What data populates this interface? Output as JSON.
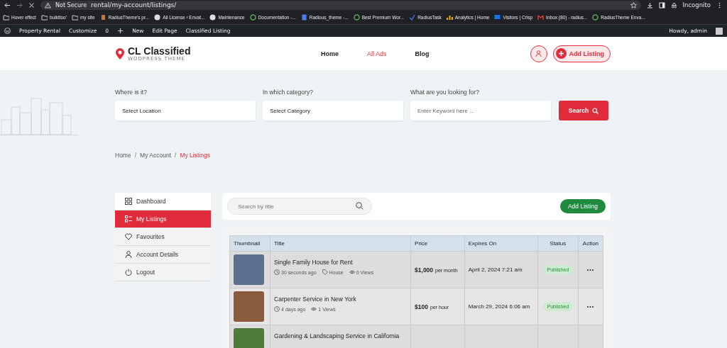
{
  "browser": {
    "security": "Not Secure",
    "url": "rental/my-account/listings/",
    "profile": "Incognito"
  },
  "bookmarks": [
    {
      "label": "Hover effect",
      "kind": "folder"
    },
    {
      "label": "buildtoo'",
      "kind": "folder"
    },
    {
      "label": "my site",
      "kind": "folder"
    },
    {
      "label": "RadiusTheme's pr...",
      "kind": "page"
    },
    {
      "label": "All License ‹ Envat...",
      "kind": "wp"
    },
    {
      "label": "Maintenance",
      "kind": "wp"
    },
    {
      "label": "Documentation -...",
      "kind": "g"
    },
    {
      "label": "Radious_theme -...",
      "kind": "doc"
    },
    {
      "label": "Best Premium Wor...",
      "kind": "g"
    },
    {
      "label": "RadiusTask",
      "kind": "task"
    },
    {
      "label": "Analytics | Home",
      "kind": "chart"
    },
    {
      "label": "Visitors | Crisp",
      "kind": "chat"
    },
    {
      "label": "Inbox (80) - radius...",
      "kind": "mail"
    },
    {
      "label": "RadiusTheme Enva...",
      "kind": "g"
    }
  ],
  "admin_bar": {
    "site": "Property Rental",
    "customize": "Customize",
    "comments": "0",
    "new": "New",
    "edit": "Edit Page",
    "plugin": "Classified Listing",
    "greeting": "Howdy, admin"
  },
  "header": {
    "logo_title": "CL Classified",
    "logo_subtitle": "WODPRESS THEME",
    "nav": [
      {
        "label": "Home",
        "selected": false
      },
      {
        "label": "All Ads",
        "selected": true
      },
      {
        "label": "Blog",
        "selected": false
      }
    ],
    "add_listing": "Add Listing"
  },
  "search": {
    "fields": [
      {
        "label": "Where is it?",
        "value": "Select Location",
        "kind": "select"
      },
      {
        "label": "In which category?",
        "value": "Select Category",
        "kind": "select"
      },
      {
        "label": "What are you looking for?",
        "placeholder": "Enter Keyword here ...",
        "kind": "text"
      }
    ],
    "button": "Search"
  },
  "breadcrumbs": {
    "separator": "/",
    "items": [
      {
        "label": "Home",
        "current": false
      },
      {
        "label": "My Account",
        "current": false
      },
      {
        "label": "My Listings",
        "current": true
      }
    ]
  },
  "sidebar": {
    "items": [
      {
        "label": "Dashboard",
        "kind": "grid",
        "selected": false
      },
      {
        "label": "My Listings",
        "kind": "list",
        "selected": true
      },
      {
        "label": "Favourites",
        "kind": "heart",
        "selected": false
      },
      {
        "label": "Account Details",
        "kind": "user",
        "selected": false
      },
      {
        "label": "Logout",
        "kind": "power",
        "selected": false
      }
    ]
  },
  "toolbar": {
    "search_placeholder": "Search by title",
    "add_button": "Add Listing"
  },
  "table": {
    "columns": [
      "Thumbnail",
      "Title",
      "Price",
      "Expires On",
      "Status",
      "Action"
    ],
    "rows": [
      {
        "title": "Single Family House for Rent",
        "meta": [
          {
            "kind": "time",
            "text": "30 seconds ago"
          },
          {
            "kind": "category",
            "text": "House"
          },
          {
            "kind": "views",
            "text": "0 Views"
          }
        ],
        "price": "$1,000",
        "price_unit": "per month",
        "expires": "April 2, 2024 7:21 am",
        "status": "Published",
        "action": "•••"
      },
      {
        "title": "Carpenter Service in New York",
        "meta": [
          {
            "kind": "time",
            "text": "4 days ago"
          },
          {
            "kind": "views",
            "text": "1 Views"
          }
        ],
        "price": "$100",
        "price_unit": "per hour",
        "expires": "March 29, 2024 6:06 am",
        "status": "Published",
        "action": "•••"
      },
      {
        "title": "Gardening & Landscaping Service in California"
      }
    ]
  }
}
